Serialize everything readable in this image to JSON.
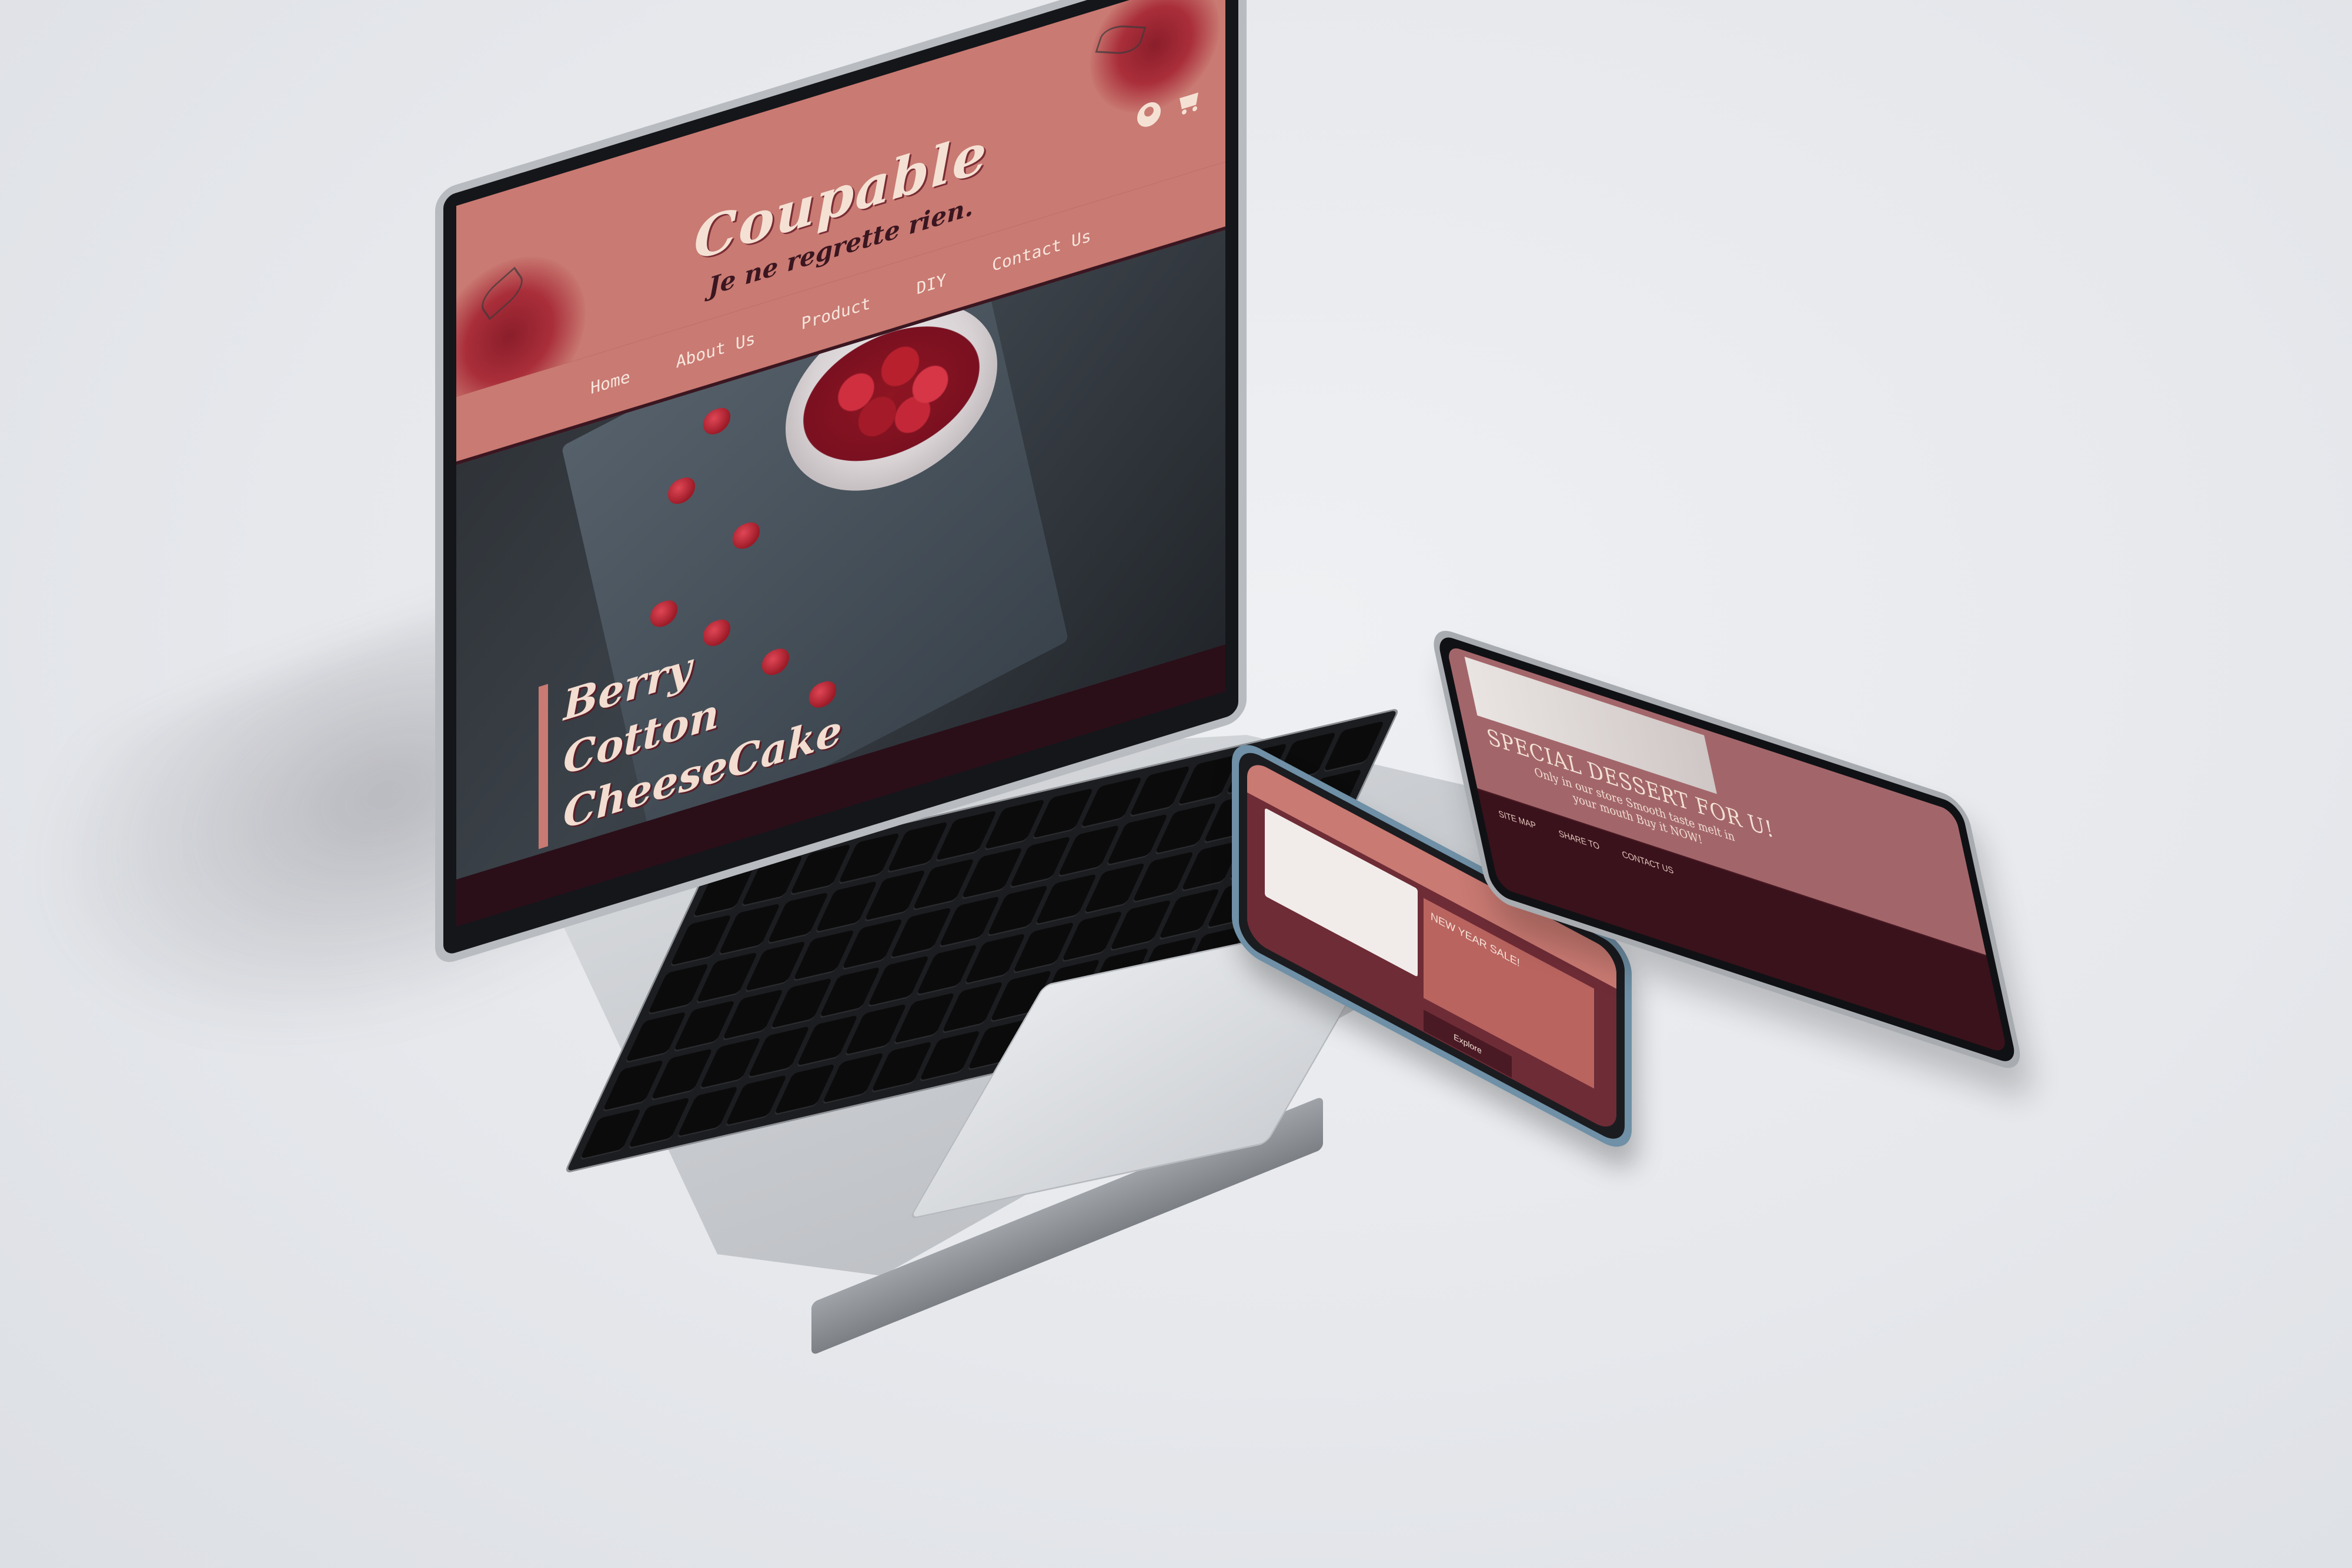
{
  "laptop_site": {
    "brand": "Coupable",
    "tagline": "Je ne regrette rien.",
    "nav": [
      "Home",
      "About Us",
      "Product",
      "DIY",
      "Contact Us"
    ],
    "hero_lines": [
      "Berry",
      "Cotton",
      "CheeseCake"
    ]
  },
  "phone_site": {
    "card_text": "NEW YEAR SALE!",
    "button_label": "Explore"
  },
  "tablet_site": {
    "hero_title": "SPECIAL DESSERT FOR U!",
    "hero_body": "Only in our store Smooth taste melt in your mouth Buy it NOW!",
    "footer_cols": [
      "SITE MAP",
      "SHARE TO",
      "CONTACT US"
    ]
  },
  "colors": {
    "rose": "#c97a72",
    "burgundy": "#2a0f18",
    "cream": "#f4e1d4",
    "backdrop": "#e6e8ec"
  }
}
